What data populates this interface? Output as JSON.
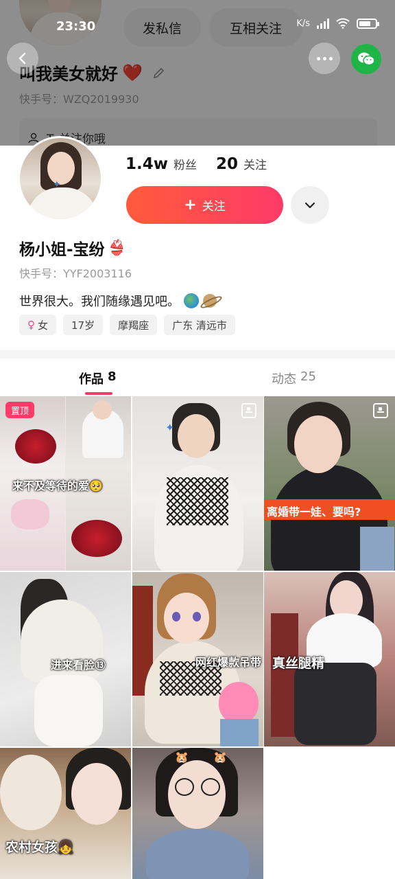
{
  "status_bar": {
    "time": "23:30",
    "network": "K/s",
    "battery_icon": "battery-icon"
  },
  "background_profile": {
    "buttons": [
      "发私信",
      "互相关注"
    ],
    "name": "叫我美女就好",
    "name_emoji": "❤️",
    "kuaishou_id": "快手号：WZQ2019930",
    "follow_hint": "Ta关注你哦"
  },
  "profile": {
    "followers_count": "1.4w",
    "followers_label": "粉丝",
    "following_count": "20",
    "following_label": "关注",
    "follow_button_label": "关注",
    "name": "杨小姐-宝纷",
    "name_emoji": "👙",
    "kuaishou_id": "快手号：YYF2003116",
    "bio": "世界很大。我们随缘遇见吧。",
    "tags": [
      {
        "icon": "female-icon",
        "label": "女"
      },
      {
        "label": "17岁"
      },
      {
        "label": "摩羯座"
      },
      {
        "label": "广东 清远市"
      }
    ]
  },
  "tabs": [
    {
      "label": "作品",
      "count": "8",
      "active": true
    },
    {
      "label": "动态",
      "count": "25",
      "active": false
    }
  ],
  "works": [
    {
      "pinned_label": "置顶",
      "caption": "来不及等待的爱🥺"
    },
    {
      "caption": ""
    },
    {
      "caption": "离婚带一娃、要吗?"
    },
    {
      "caption": "进来看脸⑬"
    },
    {
      "caption": "网红爆款吊带"
    },
    {
      "caption": "真丝腿精"
    },
    {
      "caption": "农村女孩👧"
    },
    {
      "caption": ""
    }
  ],
  "colors": {
    "accent": "#fe3a68",
    "follow_gradient_start": "#ff5a3c",
    "wechat": "#1fb546"
  }
}
